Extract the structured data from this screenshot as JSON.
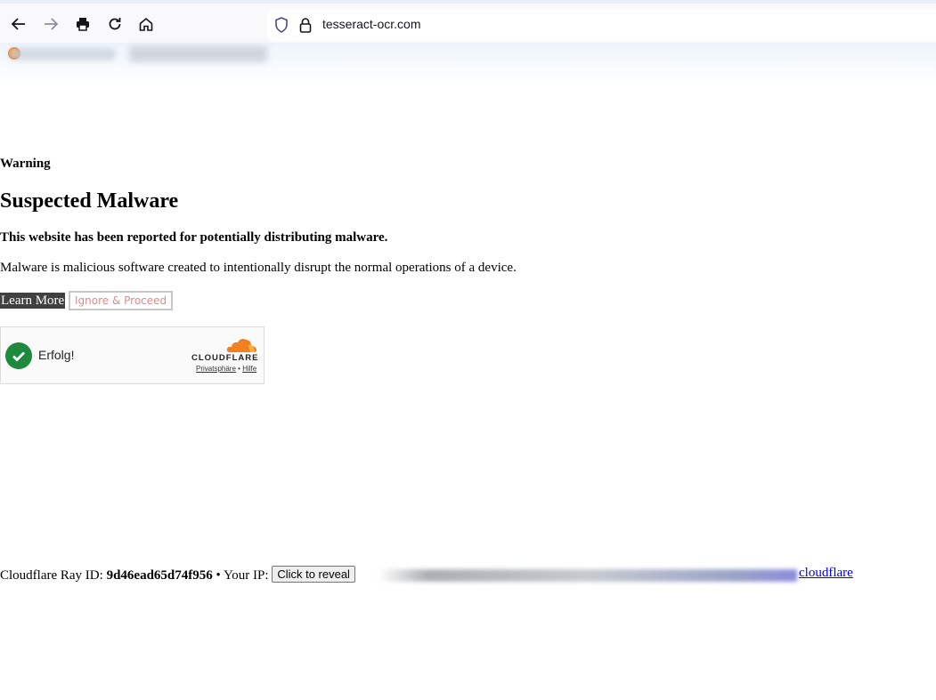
{
  "browser": {
    "url": "tesseract-ocr.com",
    "icons": [
      "back-arrow-icon",
      "forward-arrow-icon",
      "print-icon",
      "reload-icon",
      "home-icon",
      "shield-icon",
      "lock-icon"
    ]
  },
  "page": {
    "warning_label": "Warning",
    "title": "Suspected Malware",
    "reported_text": "This website has been reported for potentially distributing malware.",
    "description": "Malware is malicious software created to intentionally disrupt the normal operations of a device.",
    "learn_more_label": "Learn More",
    "ignore_label": "Ignore & Proceed"
  },
  "turnstile": {
    "status_text": "Erfolg!",
    "brand": "CLOUDFLARE",
    "privacy_link": "Privatsphäre",
    "separator": "•",
    "help_link": "Hilfe"
  },
  "footer": {
    "ray_label": "Cloudflare Ray ID:",
    "ray_id": "9d46ead65d74f956",
    "bullet": "•",
    "ip_label": "Your IP:",
    "reveal_label": "Click to reveal",
    "cloudflare_link": "cloudflare"
  },
  "colors": {
    "learn_more_bg": "#404040",
    "ignore_text": "#e08a8a",
    "success_green": "#1e8a3e",
    "cloudflare_orange": "#f38020",
    "link_blue": "#0000ee"
  }
}
